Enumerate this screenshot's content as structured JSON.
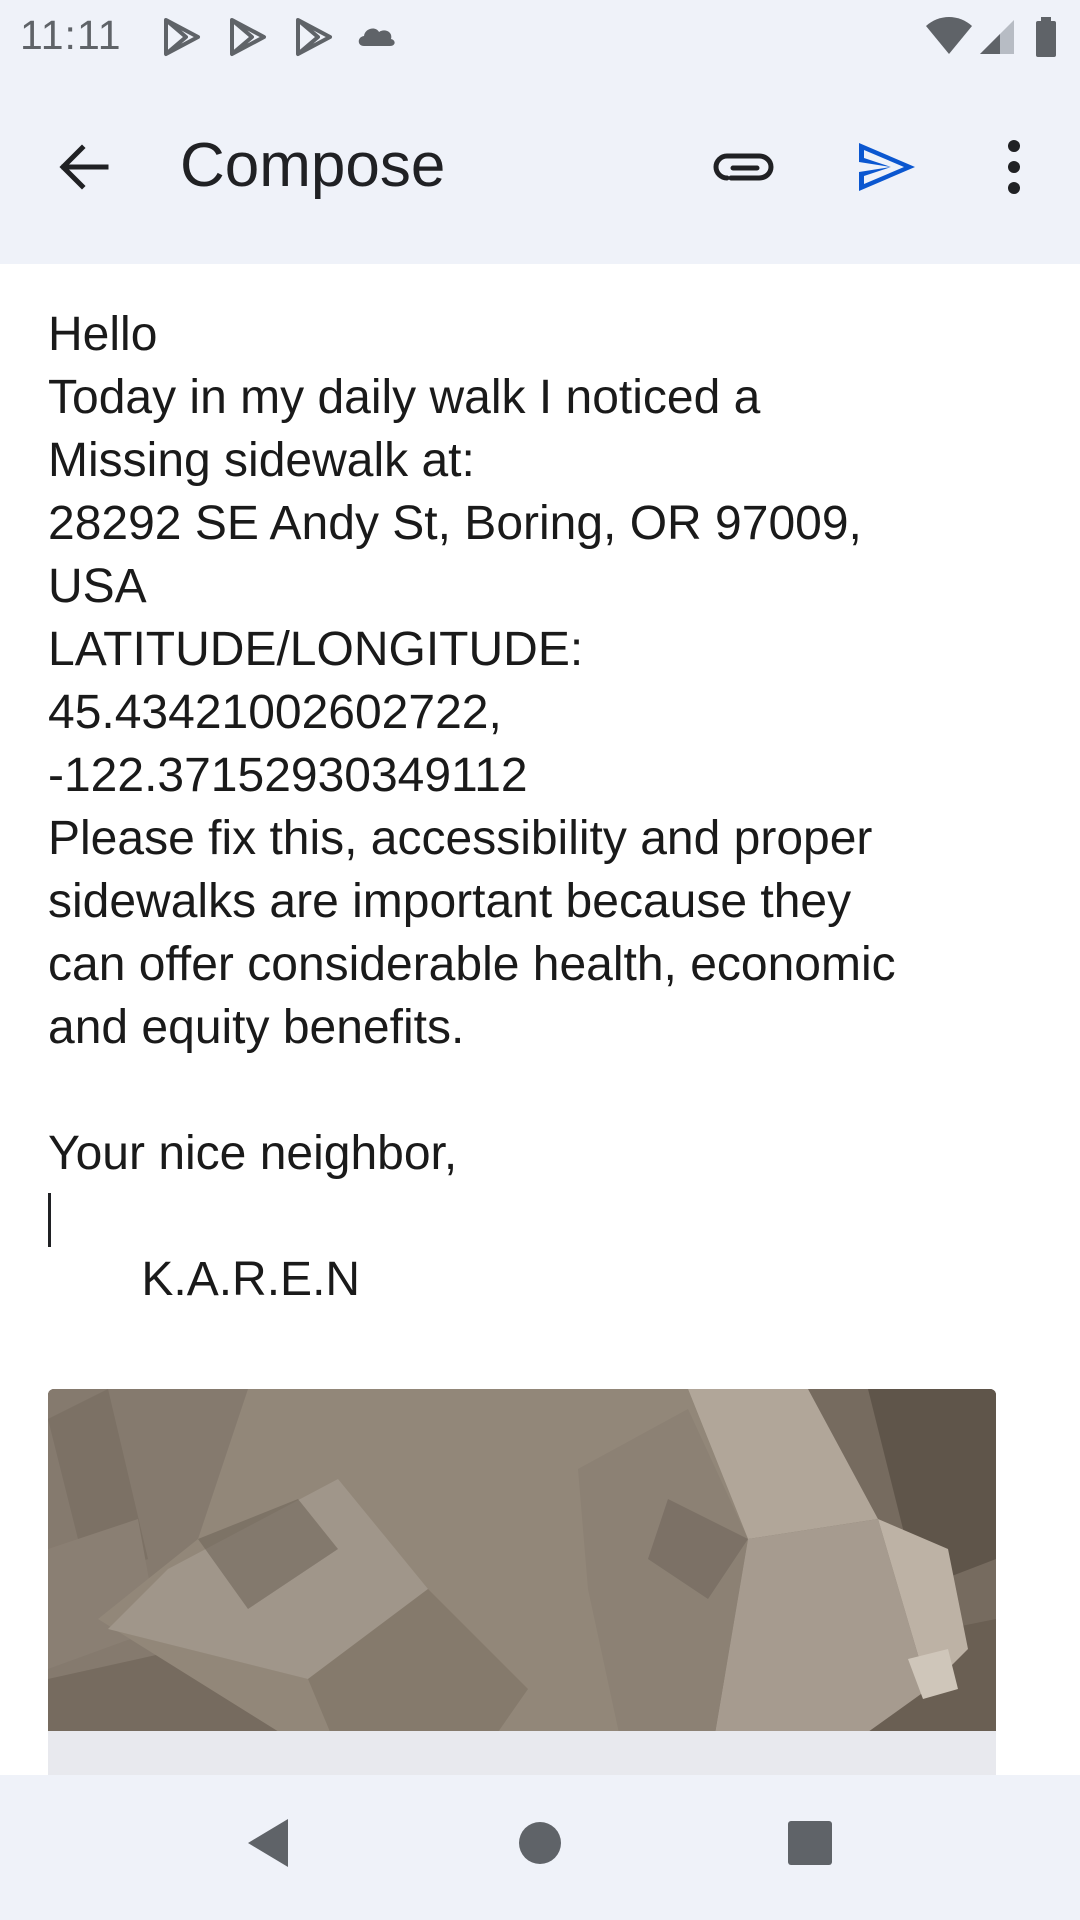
{
  "status_bar": {
    "time": "11:11",
    "left_icons": [
      "play-store-icon",
      "play-store-icon",
      "play-store-icon",
      "cloud-icon"
    ],
    "right_icons": [
      "wifi-icon",
      "cellular-signal-icon",
      "battery-icon"
    ]
  },
  "app_bar": {
    "title": "Compose",
    "back_icon": "arrow-back-icon",
    "attach_icon": "paperclip-icon",
    "send_icon": "send-icon",
    "more_icon": "more-vert-icon"
  },
  "body": {
    "lines": [
      "Hello",
      "Today in my daily walk I noticed a",
      "Missing sidewalk at:",
      "28292 SE Andy St, Boring, OR 97009,",
      "USA",
      "LATITUDE/LONGITUDE:",
      "45.43421002602722,",
      "-122.37152930349112",
      "Please fix this, accessibility and proper",
      "sidewalks are important because they",
      "can offer considerable health, economic",
      "and equity benefits.",
      "",
      "Your nice neighbor,"
    ],
    "signature": " K.A.R.E.N"
  },
  "nav_bar": {
    "back_icon": "nav-back-icon",
    "home_icon": "nav-home-icon",
    "recents_icon": "nav-recents-icon"
  },
  "colors": {
    "bar_background": "#eff2f9",
    "send_accent": "#0b57d0",
    "text": "#1a1a1a",
    "icon_gray": "#5f6368"
  }
}
